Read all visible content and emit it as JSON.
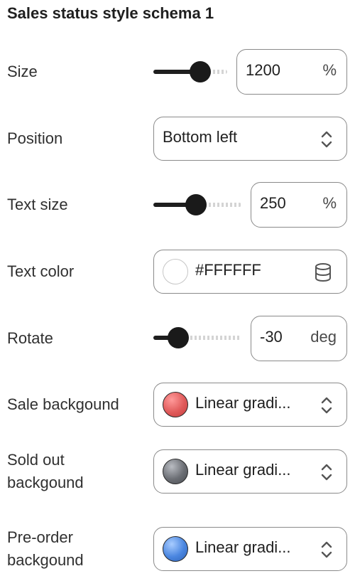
{
  "title": "Sales status style schema 1",
  "size": {
    "label": "Size",
    "value": "1200",
    "unit": "%",
    "slider_fraction": 0.52
  },
  "position": {
    "label": "Position",
    "value": "Bottom left"
  },
  "text_size": {
    "label": "Text size",
    "value": "250",
    "unit": "%",
    "slider_fraction": 0.48
  },
  "text_color": {
    "label": "Text color",
    "value": "#FFFFFF",
    "swatch_color": "#FFFFFF",
    "icon": "database-icon"
  },
  "rotate": {
    "label": "Rotate",
    "value": "-30",
    "unit": "deg",
    "slider_fraction": 0.27
  },
  "sale_background": {
    "label": "Sale backgound",
    "value": "Linear gradi...",
    "swatch_color": "#e05a5a"
  },
  "sold_out_background": {
    "label_line1": "Sold out",
    "label_line2": "backgound",
    "value": "Linear gradi...",
    "swatch_color": "#6b6e74"
  },
  "pre_order_background": {
    "label_line1": "Pre-order",
    "label_line2": "backgound",
    "value": "Linear gradi...",
    "swatch_color": "#4a86e0"
  }
}
